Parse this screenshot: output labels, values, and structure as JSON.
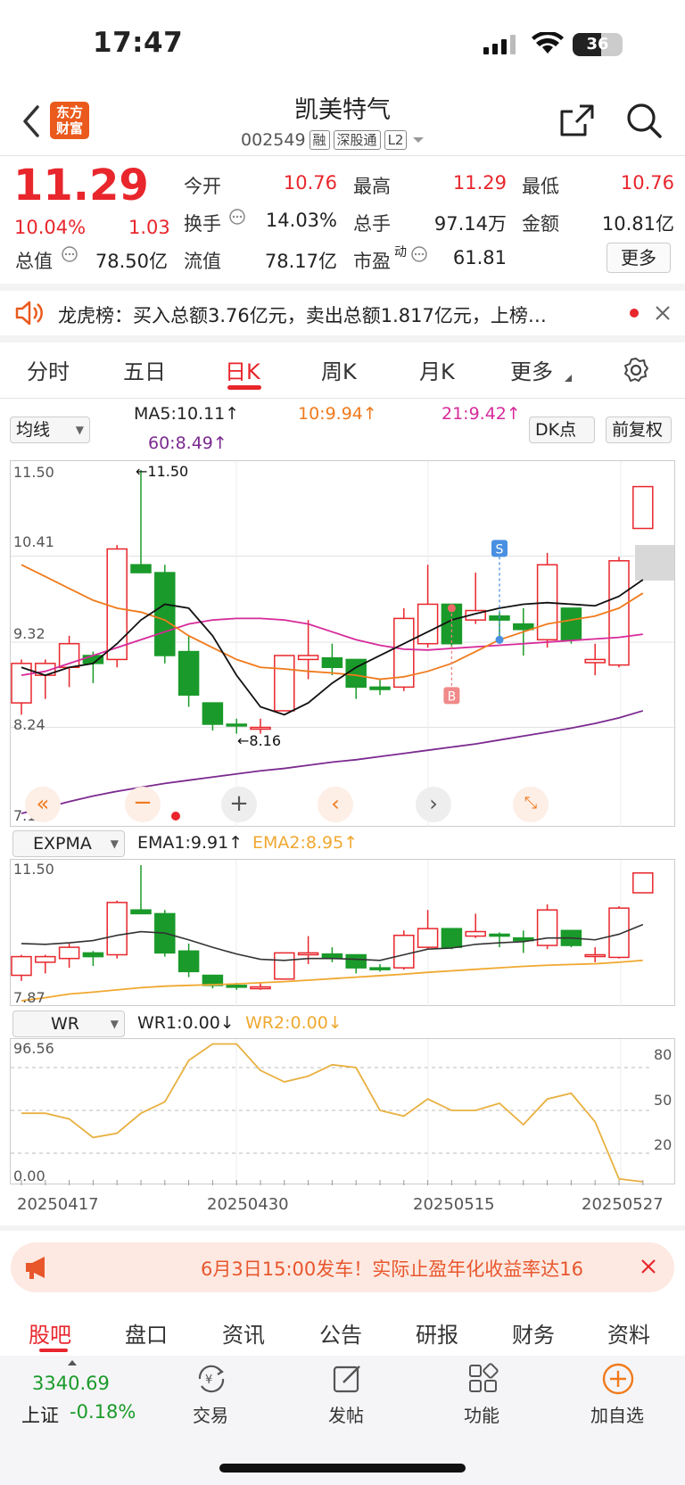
{
  "status": {
    "time": "17:47",
    "battery": "36"
  },
  "header": {
    "logo_text_1": "东方",
    "logo_text_2": "财富",
    "title": "凯美特气",
    "code": "002549",
    "tags": [
      "融",
      "深股通",
      "L2"
    ]
  },
  "quote": {
    "price": "11.29",
    "pct": "10.04%",
    "change": "1.03",
    "open_label": "今开",
    "open": "10.76",
    "high_label": "最高",
    "high": "11.29",
    "low_label": "最低",
    "low": "10.76",
    "turnover_label": "换手",
    "turnover": "14.03%",
    "volume_label": "总手",
    "volume": "97.14万",
    "amount_label": "金额",
    "amount": "10.81亿",
    "mcap_label": "总值",
    "mcap": "78.50亿",
    "float_label": "流值",
    "float": "78.17亿",
    "pe_label": "市盈",
    "pe_sup": "动",
    "pe": "61.81",
    "more": "更多"
  },
  "notice": {
    "text": "龙虎榜：买入总额3.76亿元，卖出总额1.817亿元，上榜…"
  },
  "tabs": [
    "分时",
    "五日",
    "日K",
    "周K",
    "月K",
    "更多"
  ],
  "indicators": {
    "main_select": "均线",
    "ma5": "MA5:10.11↑",
    "ma10": "10:9.94↑",
    "ma21": "21:9.42↑",
    "ma60": "60:8.49↑",
    "dk": "DK点",
    "fq": "前复权",
    "sub1_select": "EXPMA",
    "ema1": "EMA1:9.91↑",
    "ema2": "EMA2:8.95↑",
    "sub2_select": "WR",
    "wr1": "WR1:0.00↓",
    "wr2": "WR2:0.00↓"
  },
  "chart_data": {
    "type": "candlestick",
    "main_axis": [
      "11.50",
      "10.41",
      "9.32",
      "8.24",
      "7.15"
    ],
    "max_label": "←11.50",
    "min_label": "←8.16",
    "ema_axis": [
      "11.50",
      "7.87"
    ],
    "wr_axis_left": [
      "96.56",
      "0.00"
    ],
    "wr_axis_right": [
      "80",
      "50",
      "20"
    ],
    "dates": [
      "20250417",
      "20250430",
      "20250515",
      "20250527"
    ],
    "buy_marker": "B",
    "sell_marker": "S",
    "candles": [
      {
        "o": 8.55,
        "h": 9.1,
        "l": 8.4,
        "c": 9.05
      },
      {
        "o": 8.9,
        "h": 9.1,
        "l": 8.6,
        "c": 9.05
      },
      {
        "o": 9.0,
        "h": 9.4,
        "l": 8.75,
        "c": 9.3
      },
      {
        "o": 9.15,
        "h": 9.2,
        "l": 8.8,
        "c": 9.05
      },
      {
        "o": 9.1,
        "h": 10.55,
        "l": 9.0,
        "c": 10.5
      },
      {
        "o": 10.3,
        "h": 11.5,
        "l": 10.2,
        "c": 10.2
      },
      {
        "o": 10.2,
        "h": 10.3,
        "l": 9.05,
        "c": 9.15
      },
      {
        "o": 9.2,
        "h": 9.4,
        "l": 8.5,
        "c": 8.65
      },
      {
        "o": 8.55,
        "h": 8.55,
        "l": 8.2,
        "c": 8.28
      },
      {
        "o": 8.28,
        "h": 8.35,
        "l": 8.16,
        "c": 8.26
      },
      {
        "o": 8.24,
        "h": 8.35,
        "l": 8.16,
        "c": 8.24
      },
      {
        "o": 8.45,
        "h": 9.15,
        "l": 8.45,
        "c": 9.15
      },
      {
        "o": 9.1,
        "h": 9.6,
        "l": 8.85,
        "c": 9.15
      },
      {
        "o": 9.12,
        "h": 9.3,
        "l": 8.9,
        "c": 9.0
      },
      {
        "o": 9.1,
        "h": 9.1,
        "l": 8.6,
        "c": 8.75
      },
      {
        "o": 8.75,
        "h": 8.85,
        "l": 8.65,
        "c": 8.72
      },
      {
        "o": 8.75,
        "h": 9.75,
        "l": 8.7,
        "c": 9.62
      },
      {
        "o": 9.3,
        "h": 10.3,
        "l": 9.25,
        "c": 9.8
      },
      {
        "o": 9.8,
        "h": 9.8,
        "l": 9.25,
        "c": 9.3
      },
      {
        "o": 9.6,
        "h": 10.2,
        "l": 9.55,
        "c": 9.72
      },
      {
        "o": 9.65,
        "h": 9.7,
        "l": 9.3,
        "c": 9.6
      },
      {
        "o": 9.55,
        "h": 9.75,
        "l": 9.15,
        "c": 9.48
      },
      {
        "o": 9.35,
        "h": 10.45,
        "l": 9.25,
        "c": 10.3
      },
      {
        "o": 9.75,
        "h": 9.75,
        "l": 9.3,
        "c": 9.35
      },
      {
        "o": 9.06,
        "h": 9.3,
        "l": 8.9,
        "c": 9.1
      },
      {
        "o": 9.03,
        "h": 10.4,
        "l": 9.0,
        "c": 10.35
      },
      {
        "o": 10.76,
        "h": 11.29,
        "l": 10.76,
        "c": 11.29
      }
    ],
    "ma5": [
      9.0,
      8.9,
      9.0,
      9.05,
      9.3,
      9.6,
      9.8,
      9.75,
      9.4,
      8.9,
      8.5,
      8.4,
      8.55,
      8.8,
      9.0,
      9.15,
      9.3,
      9.45,
      9.6,
      9.68,
      9.75,
      9.8,
      9.82,
      9.8,
      9.78,
      9.9,
      10.11
    ],
    "ma10": [
      10.3,
      10.15,
      10.0,
      9.85,
      9.75,
      9.7,
      9.6,
      9.4,
      9.25,
      9.1,
      9.0,
      8.98,
      8.95,
      8.93,
      8.9,
      8.85,
      8.88,
      8.95,
      9.05,
      9.2,
      9.35,
      9.45,
      9.55,
      9.6,
      9.65,
      9.75,
      9.94
    ],
    "ma21": [
      8.9,
      8.95,
      9.05,
      9.15,
      9.25,
      9.35,
      9.45,
      9.55,
      9.6,
      9.62,
      9.62,
      9.6,
      9.55,
      9.45,
      9.35,
      9.28,
      9.23,
      9.22,
      9.24,
      9.26,
      9.28,
      9.3,
      9.32,
      9.34,
      9.36,
      9.38,
      9.42
    ],
    "ma60": [
      7.15,
      7.22,
      7.3,
      7.37,
      7.43,
      7.48,
      7.53,
      7.57,
      7.61,
      7.65,
      7.69,
      7.72,
      7.76,
      7.8,
      7.83,
      7.87,
      7.91,
      7.95,
      7.99,
      8.03,
      8.08,
      8.13,
      8.18,
      8.23,
      8.29,
      8.36,
      8.45
    ],
    "ema1": [
      9.4,
      9.38,
      9.42,
      9.48,
      9.62,
      9.72,
      9.68,
      9.5,
      9.3,
      9.12,
      8.98,
      8.95,
      9.0,
      9.0,
      8.98,
      8.95,
      9.1,
      9.25,
      9.28,
      9.38,
      9.42,
      9.45,
      9.55,
      9.55,
      9.5,
      9.65,
      9.91
    ],
    "ema2": [
      7.87,
      7.95,
      8.05,
      8.1,
      8.16,
      8.22,
      8.26,
      8.28,
      8.3,
      8.32,
      8.35,
      8.38,
      8.42,
      8.46,
      8.5,
      8.54,
      8.58,
      8.63,
      8.67,
      8.71,
      8.75,
      8.79,
      8.82,
      8.84,
      8.86,
      8.9,
      8.95
    ],
    "wr": [
      48,
      48,
      44,
      31,
      34,
      48,
      56,
      85,
      96.56,
      96.56,
      78,
      70,
      74,
      82,
      80,
      50,
      46,
      58,
      50,
      50,
      55,
      40,
      58,
      62,
      42,
      2,
      0
    ]
  },
  "banner": {
    "text": "6月3日15:00发车！实际止盈年化收益率达16"
  },
  "bottom_tabs": [
    "股吧",
    "盘口",
    "资讯",
    "公告",
    "研报",
    "财务",
    "资料"
  ],
  "bottom_nav": {
    "index_value": "3340.69",
    "index_name": "上证",
    "index_change": "-0.18%",
    "items": [
      "交易",
      "发帖",
      "功能",
      "加自选"
    ]
  },
  "colors": {
    "up": "#e8262c",
    "down": "#1a9a2a",
    "accent": "#f07a1c"
  }
}
